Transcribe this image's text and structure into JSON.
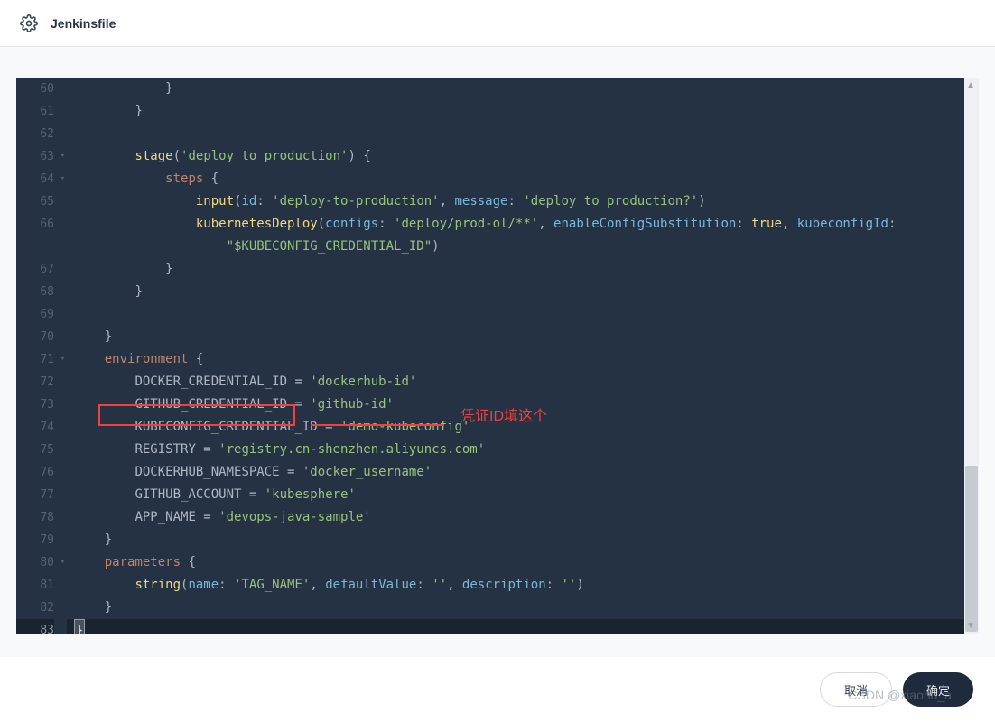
{
  "header": {
    "title": "Jenkinsfile"
  },
  "lines": {
    "60": {
      "indent": 3,
      "tokens": [
        {
          "t": "}",
          "c": ""
        }
      ]
    },
    "61": {
      "indent": 2,
      "tokens": [
        {
          "t": "}",
          "c": ""
        }
      ]
    },
    "62": {
      "indent": 0,
      "tokens": []
    },
    "63": {
      "indent": 2,
      "fold": true,
      "tokens": [
        {
          "t": "stage",
          "c": "fn"
        },
        {
          "t": "(",
          "c": ""
        },
        {
          "t": "'deploy to production'",
          "c": "str"
        },
        {
          "t": ") {",
          "c": ""
        }
      ]
    },
    "64": {
      "indent": 3,
      "fold": true,
      "tokens": [
        {
          "t": "steps",
          "c": "kw"
        },
        {
          "t": " {",
          "c": ""
        }
      ]
    },
    "65": {
      "indent": 4,
      "tokens": [
        {
          "t": "input",
          "c": "fn"
        },
        {
          "t": "(",
          "c": ""
        },
        {
          "t": "id",
          "c": "par"
        },
        {
          "t": ": ",
          "c": ""
        },
        {
          "t": "'deploy-to-production'",
          "c": "str"
        },
        {
          "t": ", ",
          "c": ""
        },
        {
          "t": "message",
          "c": "par"
        },
        {
          "t": ": ",
          "c": ""
        },
        {
          "t": "'deploy to production?'",
          "c": "str"
        },
        {
          "t": ")",
          "c": ""
        }
      ]
    },
    "66": {
      "indent": 4,
      "tokens": [
        {
          "t": "kubernetesDeploy",
          "c": "fn"
        },
        {
          "t": "(",
          "c": ""
        },
        {
          "t": "configs",
          "c": "par"
        },
        {
          "t": ": ",
          "c": ""
        },
        {
          "t": "'deploy/prod-ol/**'",
          "c": "str"
        },
        {
          "t": ", ",
          "c": ""
        },
        {
          "t": "enableConfigSubstitution",
          "c": "par"
        },
        {
          "t": ": ",
          "c": ""
        },
        {
          "t": "true",
          "c": "num"
        },
        {
          "t": ", ",
          "c": ""
        },
        {
          "t": "kubeconfigId",
          "c": "par"
        },
        {
          "t": ":",
          "c": ""
        }
      ]
    },
    "66b": {
      "indent": 5,
      "tokens": [
        {
          "t": "\"$KUBECONFIG_CREDENTIAL_ID\"",
          "c": "str"
        },
        {
          "t": ")",
          "c": ""
        }
      ]
    },
    "67": {
      "indent": 3,
      "tokens": [
        {
          "t": "}",
          "c": ""
        }
      ]
    },
    "68": {
      "indent": 2,
      "tokens": [
        {
          "t": "}",
          "c": ""
        }
      ]
    },
    "69": {
      "indent": 0,
      "tokens": []
    },
    "70": {
      "indent": 1,
      "tokens": [
        {
          "t": "}",
          "c": ""
        }
      ]
    },
    "71": {
      "indent": 1,
      "fold": true,
      "tokens": [
        {
          "t": "environment",
          "c": "kw"
        },
        {
          "t": " {",
          "c": ""
        }
      ]
    },
    "72": {
      "indent": 2,
      "tokens": [
        {
          "t": "DOCKER_CREDENTIAL_ID = ",
          "c": ""
        },
        {
          "t": "'dockerhub-id'",
          "c": "str"
        }
      ]
    },
    "73": {
      "indent": 2,
      "tokens": [
        {
          "t": "GITHUB_CREDENTIAL_ID = ",
          "c": ""
        },
        {
          "t": "'github-id'",
          "c": "str"
        }
      ]
    },
    "74": {
      "indent": 2,
      "tokens": [
        {
          "t": "KUBECONFIG_CREDENTIAL_ID = ",
          "c": ""
        },
        {
          "t": "'demo-kubeconfig'",
          "c": "str"
        }
      ]
    },
    "75": {
      "indent": 2,
      "tokens": [
        {
          "t": "REGISTRY = ",
          "c": ""
        },
        {
          "t": "'registry.cn-shenzhen.aliyuncs.com'",
          "c": "str"
        }
      ]
    },
    "76": {
      "indent": 2,
      "tokens": [
        {
          "t": "DOCKERHUB_NAMESPACE = ",
          "c": ""
        },
        {
          "t": "'docker_username'",
          "c": "str"
        }
      ]
    },
    "77": {
      "indent": 2,
      "tokens": [
        {
          "t": "GITHUB_ACCOUNT = ",
          "c": ""
        },
        {
          "t": "'kubesphere'",
          "c": "str"
        }
      ]
    },
    "78": {
      "indent": 2,
      "tokens": [
        {
          "t": "APP_NAME = ",
          "c": ""
        },
        {
          "t": "'devops-java-sample'",
          "c": "str"
        }
      ]
    },
    "79": {
      "indent": 1,
      "tokens": [
        {
          "t": "}",
          "c": ""
        }
      ]
    },
    "80": {
      "indent": 1,
      "fold": true,
      "tokens": [
        {
          "t": "parameters",
          "c": "kw"
        },
        {
          "t": " {",
          "c": ""
        }
      ]
    },
    "81": {
      "indent": 2,
      "tokens": [
        {
          "t": "string",
          "c": "fn"
        },
        {
          "t": "(",
          "c": ""
        },
        {
          "t": "name",
          "c": "par"
        },
        {
          "t": ": ",
          "c": ""
        },
        {
          "t": "'TAG_NAME'",
          "c": "str"
        },
        {
          "t": ", ",
          "c": ""
        },
        {
          "t": "defaultValue",
          "c": "par"
        },
        {
          "t": ": ",
          "c": ""
        },
        {
          "t": "''",
          "c": "str"
        },
        {
          "t": ", ",
          "c": ""
        },
        {
          "t": "description",
          "c": "par"
        },
        {
          "t": ": ",
          "c": ""
        },
        {
          "t": "''",
          "c": "str"
        },
        {
          "t": ")",
          "c": ""
        }
      ]
    },
    "82": {
      "indent": 1,
      "tokens": [
        {
          "t": "}",
          "c": ""
        }
      ]
    },
    "83": {
      "indent": 0,
      "active": true,
      "cursor": true,
      "tokens": [
        {
          "t": "}",
          "c": ""
        }
      ]
    }
  },
  "order": [
    "60",
    "61",
    "62",
    "63",
    "64",
    "65",
    "66",
    "66b",
    "67",
    "68",
    "69",
    "70",
    "71",
    "72",
    "73",
    "74",
    "75",
    "76",
    "77",
    "78",
    "79",
    "80",
    "81",
    "82",
    "83"
  ],
  "lineNumbers": {
    "60": "60",
    "61": "61",
    "62": "62",
    "63": "63",
    "64": "64",
    "65": "65",
    "66": "66",
    "66b": "",
    "67": "67",
    "68": "68",
    "69": "69",
    "70": "70",
    "71": "71",
    "72": "72",
    "73": "73",
    "74": "74",
    "75": "75",
    "76": "76",
    "77": "77",
    "78": "78",
    "79": "79",
    "80": "80",
    "81": "81",
    "82": "82",
    "83": "83"
  },
  "annotation": {
    "text": "凭证ID填这个"
  },
  "footer": {
    "cancel": "取消",
    "confirm": "确定"
  },
  "watermark": "CSDN @xiaohu_a"
}
